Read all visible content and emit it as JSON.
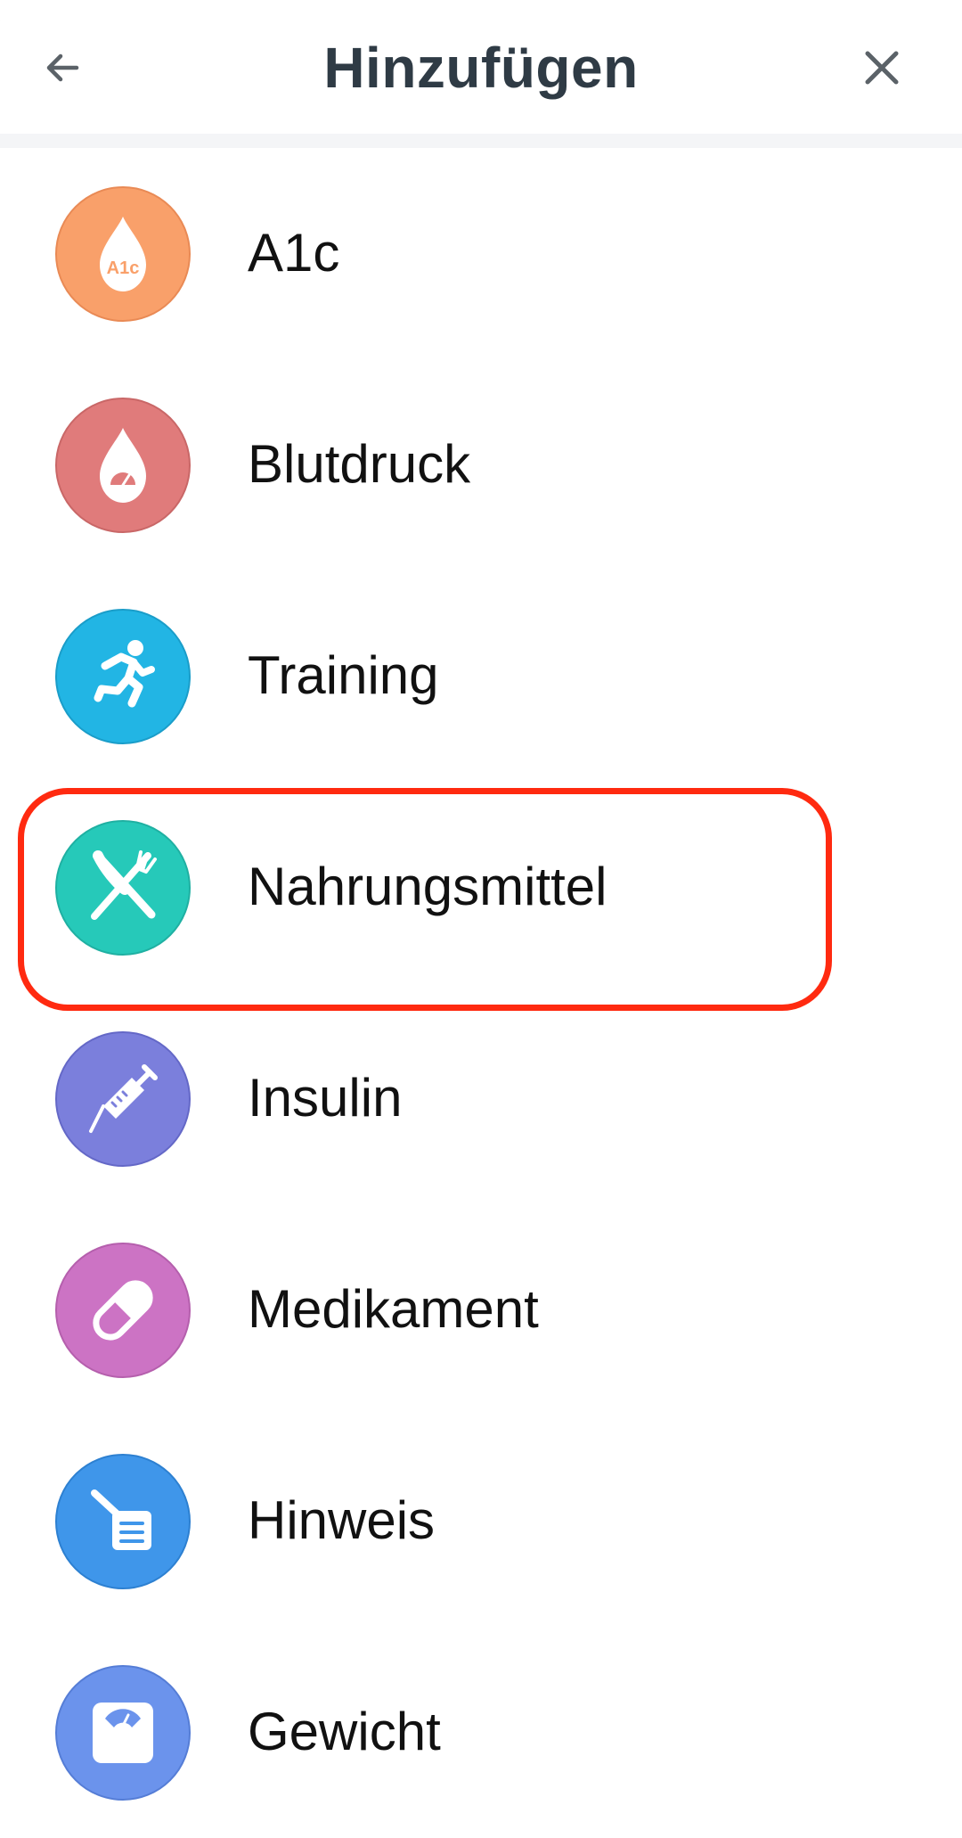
{
  "header": {
    "title": "Hinzufügen",
    "back_icon": "arrow-left-icon",
    "close_icon": "close-icon"
  },
  "items": [
    {
      "label": "A1c",
      "icon": "a1c-drop-icon",
      "color": "#f9a06a",
      "icon_text": "A1c"
    },
    {
      "label": "Blutdruck",
      "icon": "blood-pressure-drop-icon",
      "color": "#e07b7b"
    },
    {
      "label": "Training",
      "icon": "runner-icon",
      "color": "#22b5e4"
    },
    {
      "label": "Nahrungsmittel",
      "icon": "fork-knife-icon",
      "color": "#26c9b9"
    },
    {
      "label": "Insulin",
      "icon": "syringe-icon",
      "color": "#7b7fdc"
    },
    {
      "label": "Medikament",
      "icon": "pill-icon",
      "color": "#cc73c4"
    },
    {
      "label": "Hinweis",
      "icon": "note-icon",
      "color": "#3f96ea"
    },
    {
      "label": "Gewicht",
      "icon": "scale-icon",
      "color": "#6b93ec"
    }
  ],
  "highlight": {
    "target": "Nahrungsmittel",
    "color": "#ff2a10"
  }
}
